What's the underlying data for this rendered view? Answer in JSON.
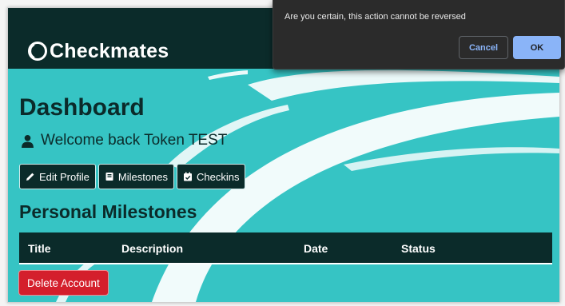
{
  "app": {
    "brand_name": "Checkmates"
  },
  "dashboard": {
    "title": "Dashboard",
    "welcome_text": "Welcome back Token TEST",
    "buttons": {
      "edit_profile": "Edit Profile",
      "milestones": "Milestones",
      "checkins": "Checkins"
    },
    "section_title": "Personal Milestones",
    "table": {
      "columns": [
        "Title",
        "Description",
        "Date",
        "Status"
      ],
      "rows": []
    },
    "delete_account_label": "Delete Account"
  },
  "dialog": {
    "message": "Are you certain, this action cannot be reversed",
    "cancel_label": "Cancel",
    "ok_label": "OK"
  },
  "colors": {
    "navbar": "#0b2b2a",
    "background": "#36c4c4",
    "danger": "#d41f2c",
    "dialog_bg": "#2b2b2b",
    "dialog_ok": "#8ab4f8"
  },
  "icons": {
    "brand": "circle-logo-icon",
    "welcome": "user-icon",
    "edit_profile": "pencil-icon",
    "milestones": "book-icon",
    "checkins": "calendar-check-icon"
  }
}
